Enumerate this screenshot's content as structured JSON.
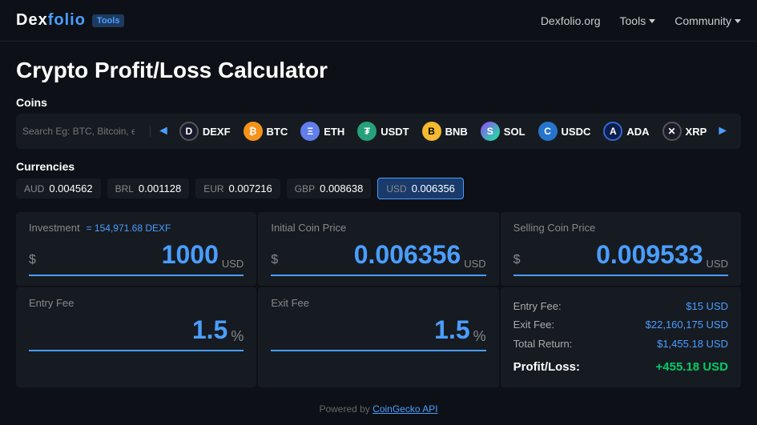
{
  "header": {
    "logo": "Dexfolio",
    "logo_accent": "folio",
    "tools_badge": "Tools",
    "nav_items": [
      {
        "label": "Dexfolio.org",
        "has_dropdown": false
      },
      {
        "label": "Tools",
        "has_dropdown": true
      },
      {
        "label": "Community",
        "has_dropdown": true
      }
    ]
  },
  "page": {
    "title": "Crypto Profit/Loss Calculator"
  },
  "coins": {
    "section_label": "Coins",
    "search_placeholder": "Search Eg: BTC, Bitcoin, etc.",
    "items": [
      {
        "symbol": "DEXF",
        "icon_class": "dexf-icon",
        "icon_text": "D"
      },
      {
        "symbol": "BTC",
        "icon_class": "btc-icon",
        "icon_text": "₿"
      },
      {
        "symbol": "ETH",
        "icon_class": "eth-icon",
        "icon_text": "Ξ"
      },
      {
        "symbol": "USDT",
        "icon_class": "usdt-icon",
        "icon_text": "₮"
      },
      {
        "symbol": "BNB",
        "icon_class": "bnb-icon",
        "icon_text": "B"
      },
      {
        "symbol": "SOL",
        "icon_class": "sol-icon",
        "icon_text": "S"
      },
      {
        "symbol": "USDC",
        "icon_class": "usdc-icon",
        "icon_text": "C"
      },
      {
        "symbol": "ADA",
        "icon_class": "ada-icon",
        "icon_text": "A"
      },
      {
        "symbol": "XRP",
        "icon_class": "xrp-icon",
        "icon_text": "X"
      }
    ]
  },
  "currencies": {
    "section_label": "Currencies",
    "items": [
      {
        "code": "AUD",
        "value": "0.004562",
        "active": false
      },
      {
        "code": "BRL",
        "value": "0.001128",
        "active": false
      },
      {
        "code": "EUR",
        "value": "0.007216",
        "active": false
      },
      {
        "code": "GBP",
        "value": "0.008638",
        "active": false
      },
      {
        "code": "USD",
        "value": "0.006356",
        "active": true
      }
    ]
  },
  "calculator": {
    "investment": {
      "label": "Investment",
      "equiv": "= 154,971.68 DEXF",
      "dollar": "$",
      "value": "1000",
      "unit": "USD"
    },
    "initial_price": {
      "label": "Initial Coin Price",
      "dollar": "$",
      "value": "0.006356",
      "unit": "USD"
    },
    "selling_price": {
      "label": "Selling Coin Price",
      "dollar": "$",
      "value": "0.009533",
      "unit": "USD"
    },
    "entry_fee": {
      "label": "Entry Fee",
      "value": "1.5",
      "unit": "%"
    },
    "exit_fee": {
      "label": "Exit Fee",
      "value": "1.5",
      "unit": "%"
    },
    "results": {
      "entry_fee_label": "Entry Fee:",
      "entry_fee_value": "$15 USD",
      "exit_fee_label": "Exit Fee:",
      "exit_fee_value": "$22,160,175 USD",
      "total_return_label": "Total Return:",
      "total_return_value": "$1,455.18 USD",
      "profit_loss_label": "Profit/Loss:",
      "profit_loss_value": "+455.18 USD"
    }
  },
  "footer": {
    "text": "Powered by ",
    "link_text": "CoinGecko API"
  }
}
